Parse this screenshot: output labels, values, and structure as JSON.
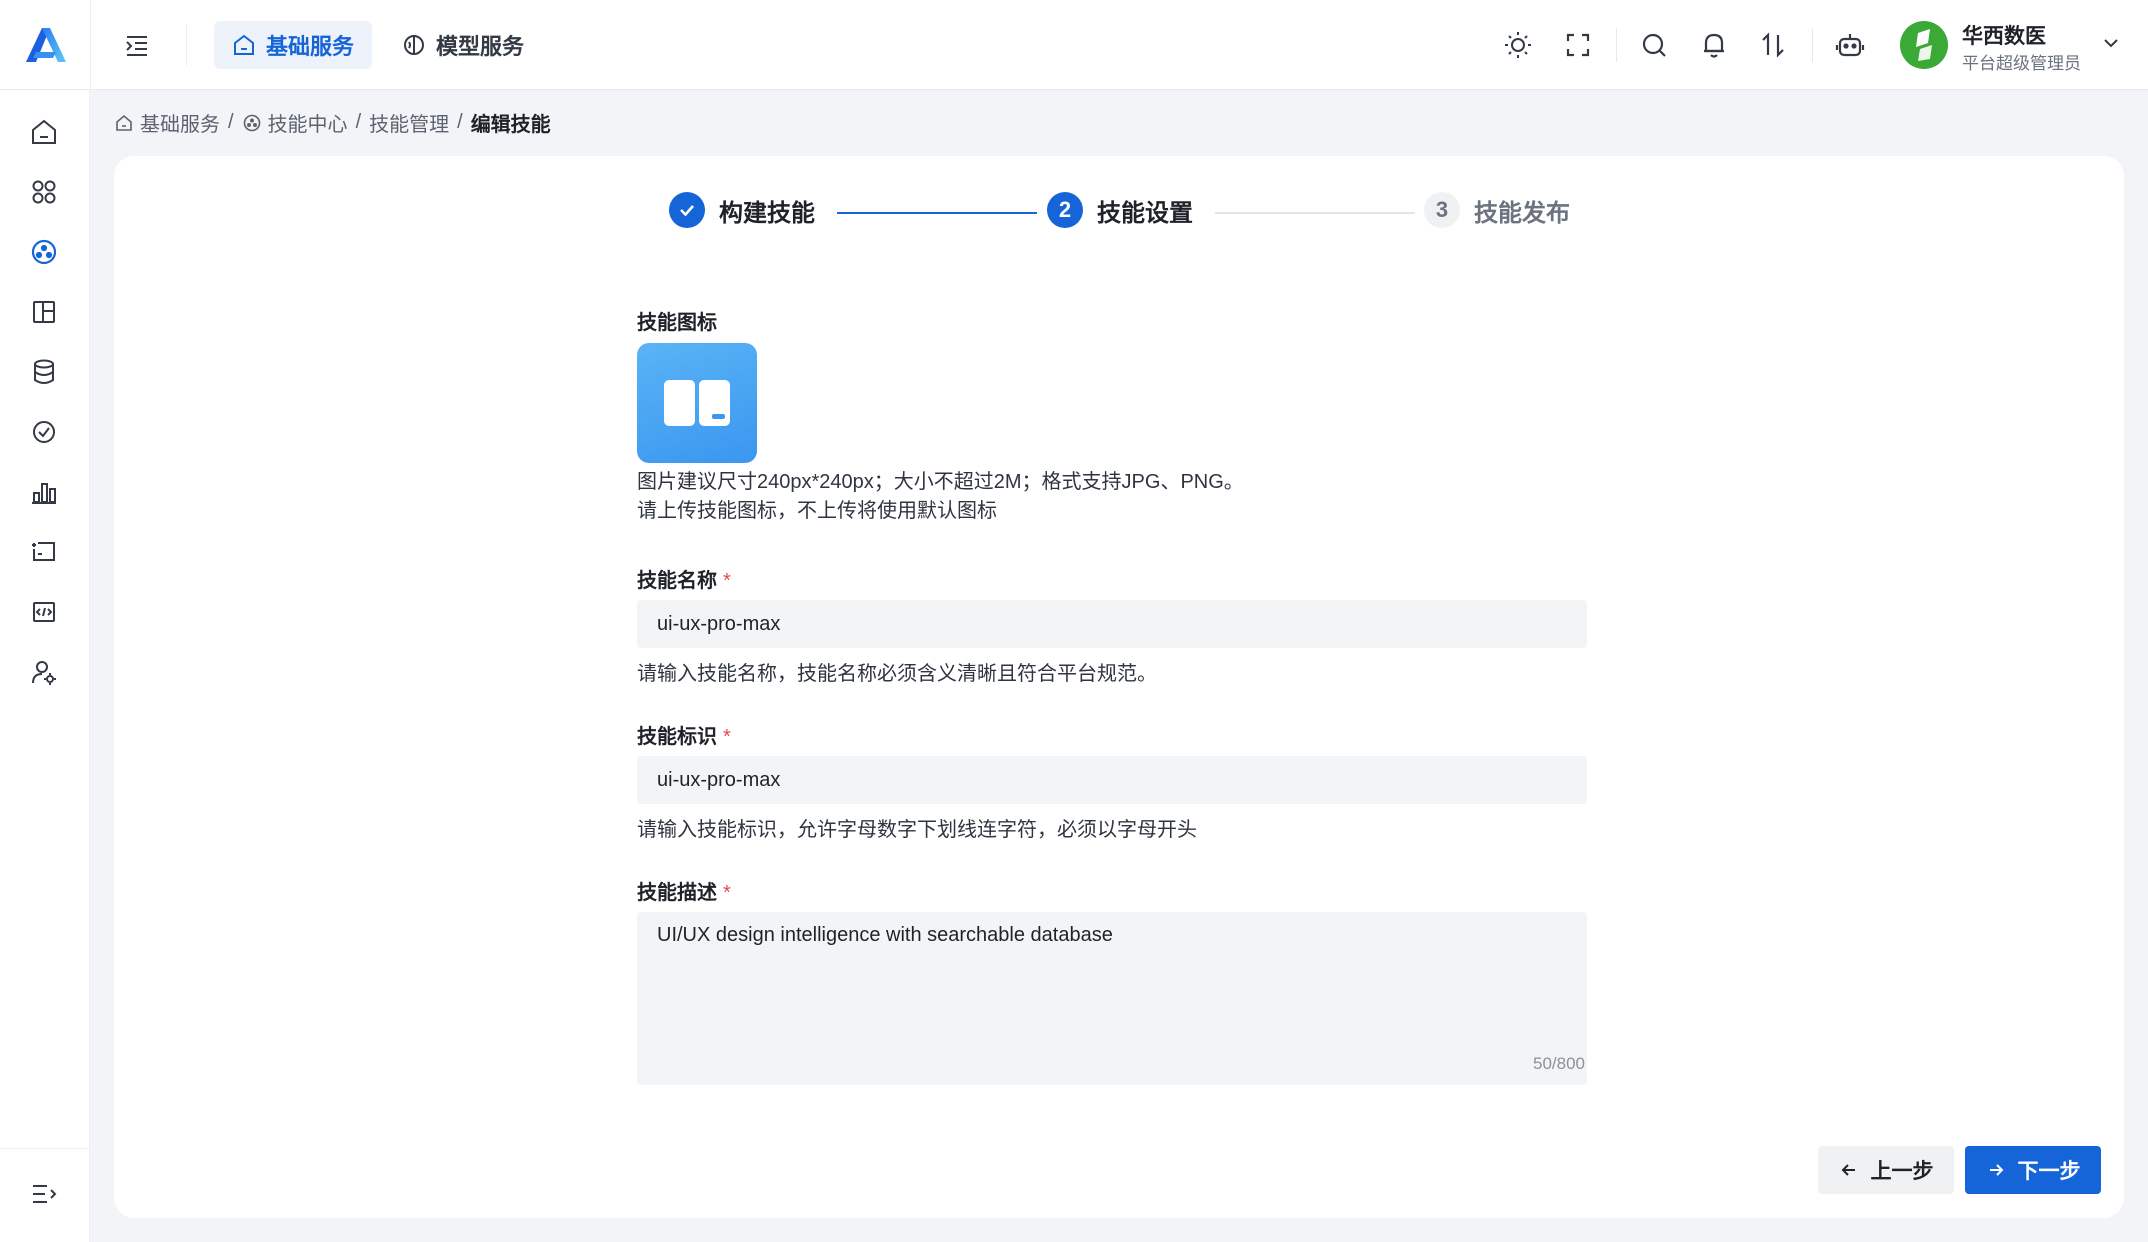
{
  "header": {
    "tabs": [
      {
        "label": "基础服务",
        "icon": "home-icon",
        "active": true
      },
      {
        "label": "模型服务",
        "icon": "brain-icon",
        "active": false
      }
    ],
    "tools": [
      "sun-icon",
      "fullscreen-icon",
      "search-icon",
      "bell-icon",
      "sort-arrows-icon",
      "robot-icon"
    ],
    "user": {
      "name": "华西数医",
      "role": "平台超级管理员"
    }
  },
  "sidebar": {
    "items": [
      "home-icon",
      "apps-grid-icon",
      "skill-center-icon",
      "layout-icon",
      "database-icon",
      "check-circle-icon",
      "bar-chart-icon",
      "monitor-icon",
      "code-icon",
      "user-settings-icon"
    ],
    "footer": "collapse-menu-icon"
  },
  "breadcrumb": {
    "items": [
      "基础服务",
      "技能中心",
      "技能管理"
    ],
    "current": "编辑技能",
    "separator": "/"
  },
  "steps": [
    {
      "number": "1",
      "label": "构建技能",
      "status": "done"
    },
    {
      "number": "2",
      "label": "技能设置",
      "status": "active"
    },
    {
      "number": "3",
      "label": "技能发布",
      "status": "pending"
    }
  ],
  "form": {
    "icon": {
      "label": "技能图标",
      "hint1": "图片建议尺寸240px*240px；大小不超过2M；格式支持JPG、PNG。",
      "hint2": "请上传技能图标，不上传将使用默认图标"
    },
    "name": {
      "label": "技能名称",
      "required": "*",
      "value": "ui-ux-pro-max",
      "hint": "请输入技能名称，技能名称必须含义清晰且符合平台规范。"
    },
    "identifier": {
      "label": "技能标识",
      "required": "*",
      "value": "ui-ux-pro-max",
      "hint": "请输入技能标识，允许字母数字下划线连字符，必须以字母开头"
    },
    "description": {
      "label": "技能描述",
      "required": "*",
      "value": "UI/UX design intelligence with searchable database",
      "count": "50/800"
    }
  },
  "actions": {
    "prev": "上一步",
    "next": "下一步"
  },
  "colors": {
    "primary": "#1565d8",
    "required": "#e5484d",
    "avatar": "#3aa935"
  }
}
